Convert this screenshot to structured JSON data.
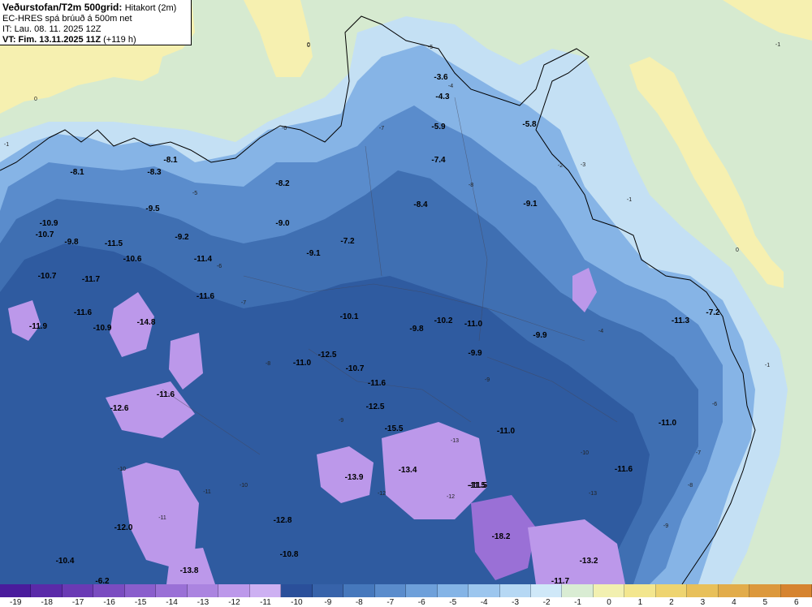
{
  "header": {
    "line1_bold": "Veðurstofan/T2m 500grid:",
    "line1_rest": "Hitakort (2m)",
    "line2": "EC-HRES spá brúuð á 500m net",
    "line3": "IT: Lau. 08. 11. 2025 12Z",
    "line4_bold": "VT: Fim. 13.11.2025 11Z",
    "line4_rest": "(+119 h)"
  },
  "legend": {
    "ticks": [
      "-19",
      "-18",
      "-17",
      "-16",
      "-15",
      "-14",
      "-13",
      "-12",
      "-11",
      "-10",
      "-9",
      "-8",
      "-7",
      "-6",
      "-5",
      "-4",
      "-3",
      "-2",
      "-1",
      "0",
      "1",
      "2",
      "3",
      "4",
      "5",
      "6"
    ],
    "colors": [
      "#4a1c9c",
      "#5a2aa8",
      "#6a3ab4",
      "#7a4cc0",
      "#8a5ecc",
      "#9a70d6",
      "#ab84e0",
      "#bc98ea",
      "#cdb0f2",
      "#2a4f9a",
      "#3763aa",
      "#4678bc",
      "#5a8ccc",
      "#6ea0da",
      "#84b4e6",
      "#9cc6ee",
      "#b6d8f4",
      "#cfe8f8",
      "#d9ecd3",
      "#f2f0b0",
      "#f3e68e",
      "#eed470",
      "#e8c05a",
      "#e2ac4a",
      "#dc983c",
      "#d68430"
    ]
  },
  "map_labels": [
    {
      "t": "-3.6"
    },
    {
      "t": "-4.3"
    },
    {
      "t": "-5.9"
    },
    {
      "t": "-5.8"
    },
    {
      "t": "-7.4"
    },
    {
      "t": "-8.4"
    },
    {
      "t": "-9.1"
    },
    {
      "t": "-8.1"
    },
    {
      "t": "-8.3"
    },
    {
      "t": "-8.1"
    },
    {
      "t": "-8.2"
    },
    {
      "t": "-9.0"
    },
    {
      "t": "-7.2"
    },
    {
      "t": "-9.1"
    },
    {
      "t": "-10.9"
    },
    {
      "t": "-10.7"
    },
    {
      "t": "-9.8"
    },
    {
      "t": "-11.5"
    },
    {
      "t": "-10.6"
    },
    {
      "t": "-9.5"
    },
    {
      "t": "-9.2"
    },
    {
      "t": "-11.4"
    },
    {
      "t": "-10.7"
    },
    {
      "t": "-11.7"
    },
    {
      "t": "-11.6"
    },
    {
      "t": "-11.6"
    },
    {
      "t": "-14.8"
    },
    {
      "t": "-11.9"
    },
    {
      "t": "-10.9"
    },
    {
      "t": "-10.1"
    },
    {
      "t": "-9.8"
    },
    {
      "t": "-10.2"
    },
    {
      "t": "-11.0"
    },
    {
      "t": "-9.9"
    },
    {
      "t": "-9.9"
    },
    {
      "t": "-7.2"
    },
    {
      "t": "-11.3"
    },
    {
      "t": "-12.5"
    },
    {
      "t": "-11.0"
    },
    {
      "t": "-10.7"
    },
    {
      "t": "-11.6"
    },
    {
      "t": "-12.5"
    },
    {
      "t": "-12.6"
    },
    {
      "t": "-11.6"
    },
    {
      "t": "-15.5"
    },
    {
      "t": "-11.0"
    },
    {
      "t": "-11.0"
    },
    {
      "t": "-11.5"
    },
    {
      "t": "-11.6"
    },
    {
      "t": "-13.9"
    },
    {
      "t": "-13.4"
    },
    {
      "t": "-11.5"
    },
    {
      "t": "-12.8"
    },
    {
      "t": "-12.0"
    },
    {
      "t": "-18.2"
    },
    {
      "t": "-10.4"
    },
    {
      "t": "-10.8"
    },
    {
      "t": "-13.2"
    },
    {
      "t": "-13.8"
    },
    {
      "t": "-6.2"
    },
    {
      "t": "-11.7"
    }
  ],
  "contour_labels": [
    "0",
    "0",
    "0",
    "-1",
    "-1",
    "-1",
    "0",
    "-1",
    "-2",
    "-3",
    "-4",
    "-5",
    "-6",
    "-7",
    "-8",
    "-9",
    "-10",
    "-11",
    "-12",
    "-13",
    "-4",
    "-5",
    "-6",
    "-7",
    "-8",
    "-9",
    "-10",
    "-11",
    "-12",
    "-13",
    "-6",
    "-7",
    "-8",
    "-9",
    "-10"
  ]
}
